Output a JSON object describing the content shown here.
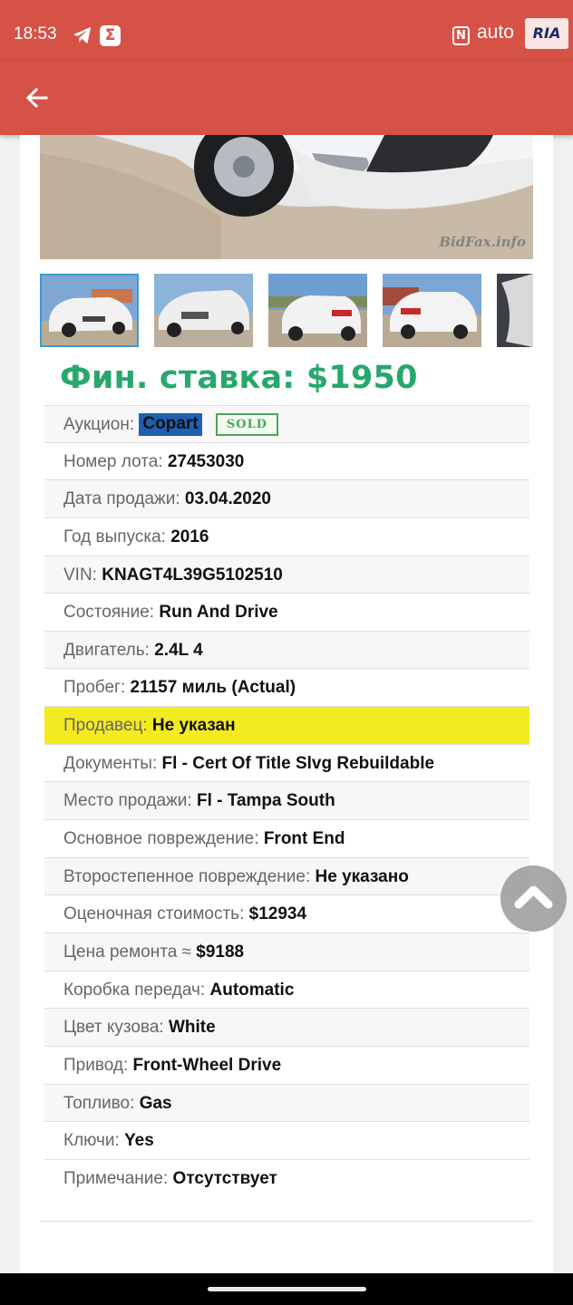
{
  "status_bar": {
    "time": "18:53",
    "icons": [
      "telegram-icon",
      "sigma-icon",
      "nfc-icon"
    ],
    "nfc_label": "N",
    "logo_text": "auto",
    "logo_badge": "RIA"
  },
  "app_bar": {
    "back_icon": "arrow-left-icon",
    "color": "#d65246"
  },
  "gallery": {
    "watermark": "BidFax.info",
    "thumbnails": [
      "thumb-1",
      "thumb-2",
      "thumb-3",
      "thumb-4",
      "thumb-5"
    ],
    "active_index": 0,
    "active_border_color": "#3a9ad6"
  },
  "price": {
    "text": "Фин. ставка: $1950",
    "color": "#27a86c"
  },
  "specs": [
    {
      "label": "Аукцион:",
      "value": "Copart",
      "badge": "SOLD"
    },
    {
      "label": "Номер лота:",
      "value": "27453030"
    },
    {
      "label": "Дата продажи:",
      "value": "03.04.2020"
    },
    {
      "label": "Год выпуска:",
      "value": "2016"
    },
    {
      "label": "VIN:",
      "value": "KNAGT4L39G5102510"
    },
    {
      "label": "Состояние:",
      "value": "Run And Drive"
    },
    {
      "label": "Двигатель:",
      "value": "2.4L 4"
    },
    {
      "label": "Пробег:",
      "value": "21157 миль (Actual)"
    },
    {
      "label": "Продавец:",
      "value": "Не указан",
      "highlight": true
    },
    {
      "label": "Документы:",
      "value": "Fl - Cert Of Title Slvg Rebuildable"
    },
    {
      "label": "Место продажи:",
      "value": "Fl - Tampa South"
    },
    {
      "label": "Основное повреждение:",
      "value": "Front End"
    },
    {
      "label": "Второстепенное повреждение:",
      "value": "Не указано"
    },
    {
      "label": "Оценочная стоимость:",
      "value": "$12934"
    },
    {
      "label": "Цена ремонта ≈",
      "value": "$9188"
    },
    {
      "label": "Коробка передач:",
      "value": "Automatic"
    },
    {
      "label": "Цвет кузова:",
      "value": "White"
    },
    {
      "label": "Привод:",
      "value": "Front-Wheel Drive"
    },
    {
      "label": "Топливо:",
      "value": "Gas"
    },
    {
      "label": "Ключи:",
      "value": "Yes"
    },
    {
      "label": "Примечание:",
      "value": "Отсутствует"
    }
  ],
  "colors": {
    "highlight": "#f4ea21",
    "copart_badge": "#1f5fb2",
    "sold_badge": "#4fa35b"
  },
  "fab": {
    "icon": "chevron-up-icon"
  }
}
